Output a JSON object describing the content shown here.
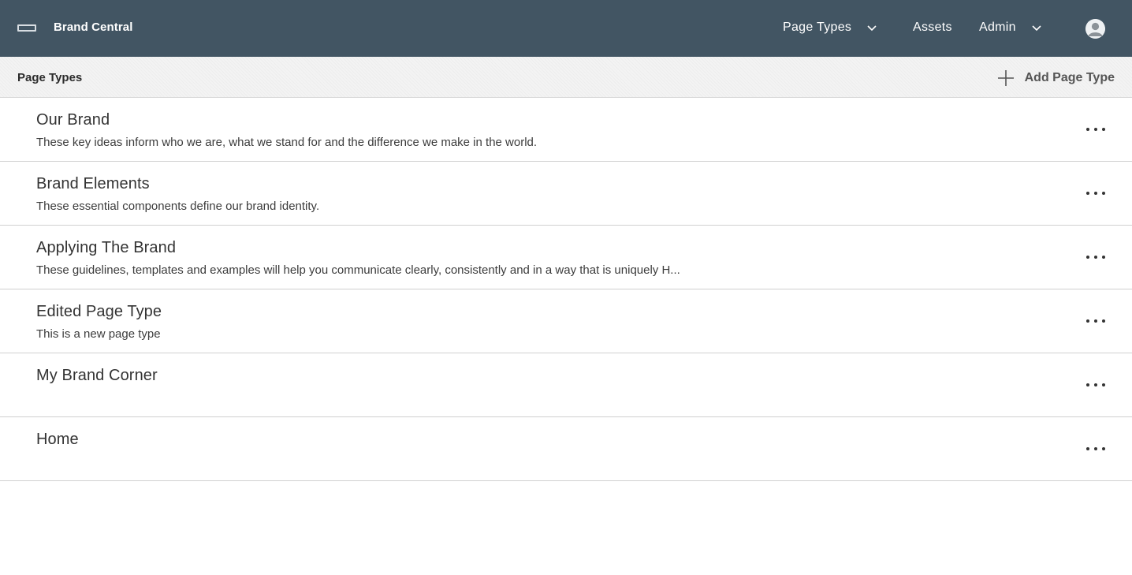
{
  "header": {
    "brand": "Brand Central",
    "nav": [
      {
        "label": "Page Types",
        "has_dropdown": true
      },
      {
        "label": "Assets",
        "has_dropdown": false
      },
      {
        "label": "Admin",
        "has_dropdown": true
      }
    ],
    "icons": {
      "menu": "menu-icon",
      "avatar": "user-avatar-icon"
    },
    "colors": {
      "bar": "#425563"
    }
  },
  "subheader": {
    "title": "Page Types",
    "add_label": "Add Page Type"
  },
  "page_types": [
    {
      "title": "Our Brand",
      "description": "These key ideas inform who we are, what we stand for and the difference we make in the world."
    },
    {
      "title": "Brand Elements",
      "description": "These essential components define our brand identity."
    },
    {
      "title": "Applying The Brand",
      "description": "These guidelines, templates and examples will help you communicate clearly, consistently and in a way that is uniquely H..."
    },
    {
      "title": "Edited Page Type",
      "description": "This is a new page type"
    },
    {
      "title": "My Brand Corner",
      "description": ""
    },
    {
      "title": "Home",
      "description": ""
    }
  ]
}
